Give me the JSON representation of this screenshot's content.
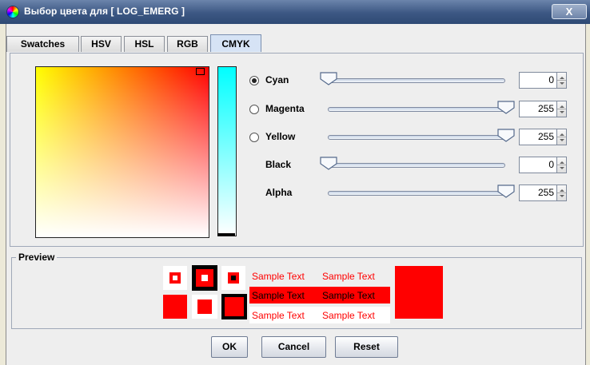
{
  "window": {
    "title": "Выбор цвета для [ LOG_EMERG ]",
    "close_label": "X"
  },
  "tabs": [
    {
      "label": "Swatches",
      "active": false
    },
    {
      "label": "HSV",
      "active": false
    },
    {
      "label": "HSL",
      "active": false
    },
    {
      "label": "RGB",
      "active": false
    },
    {
      "label": "CMYK",
      "active": true
    }
  ],
  "sliders": [
    {
      "label": "Cyan",
      "radio": true,
      "selected": true,
      "value": "0",
      "fraction": 0.0
    },
    {
      "label": "Magenta",
      "radio": true,
      "selected": false,
      "value": "255",
      "fraction": 1.0
    },
    {
      "label": "Yellow",
      "radio": true,
      "selected": false,
      "value": "255",
      "fraction": 1.0
    },
    {
      "label": "Black",
      "radio": false,
      "selected": false,
      "value": "0",
      "fraction": 0.0
    },
    {
      "label": "Alpha",
      "radio": false,
      "selected": false,
      "value": "255",
      "fraction": 1.0
    }
  ],
  "preview": {
    "title": "Preview",
    "sample_text": "Sample Text",
    "color": "#ff0000"
  },
  "buttons": {
    "ok": "OK",
    "cancel": "Cancel",
    "reset": "Reset"
  },
  "colors": {
    "selected": "#ff0000",
    "tab_active": "#d6e3f5",
    "title_bar": "#3c5783"
  }
}
